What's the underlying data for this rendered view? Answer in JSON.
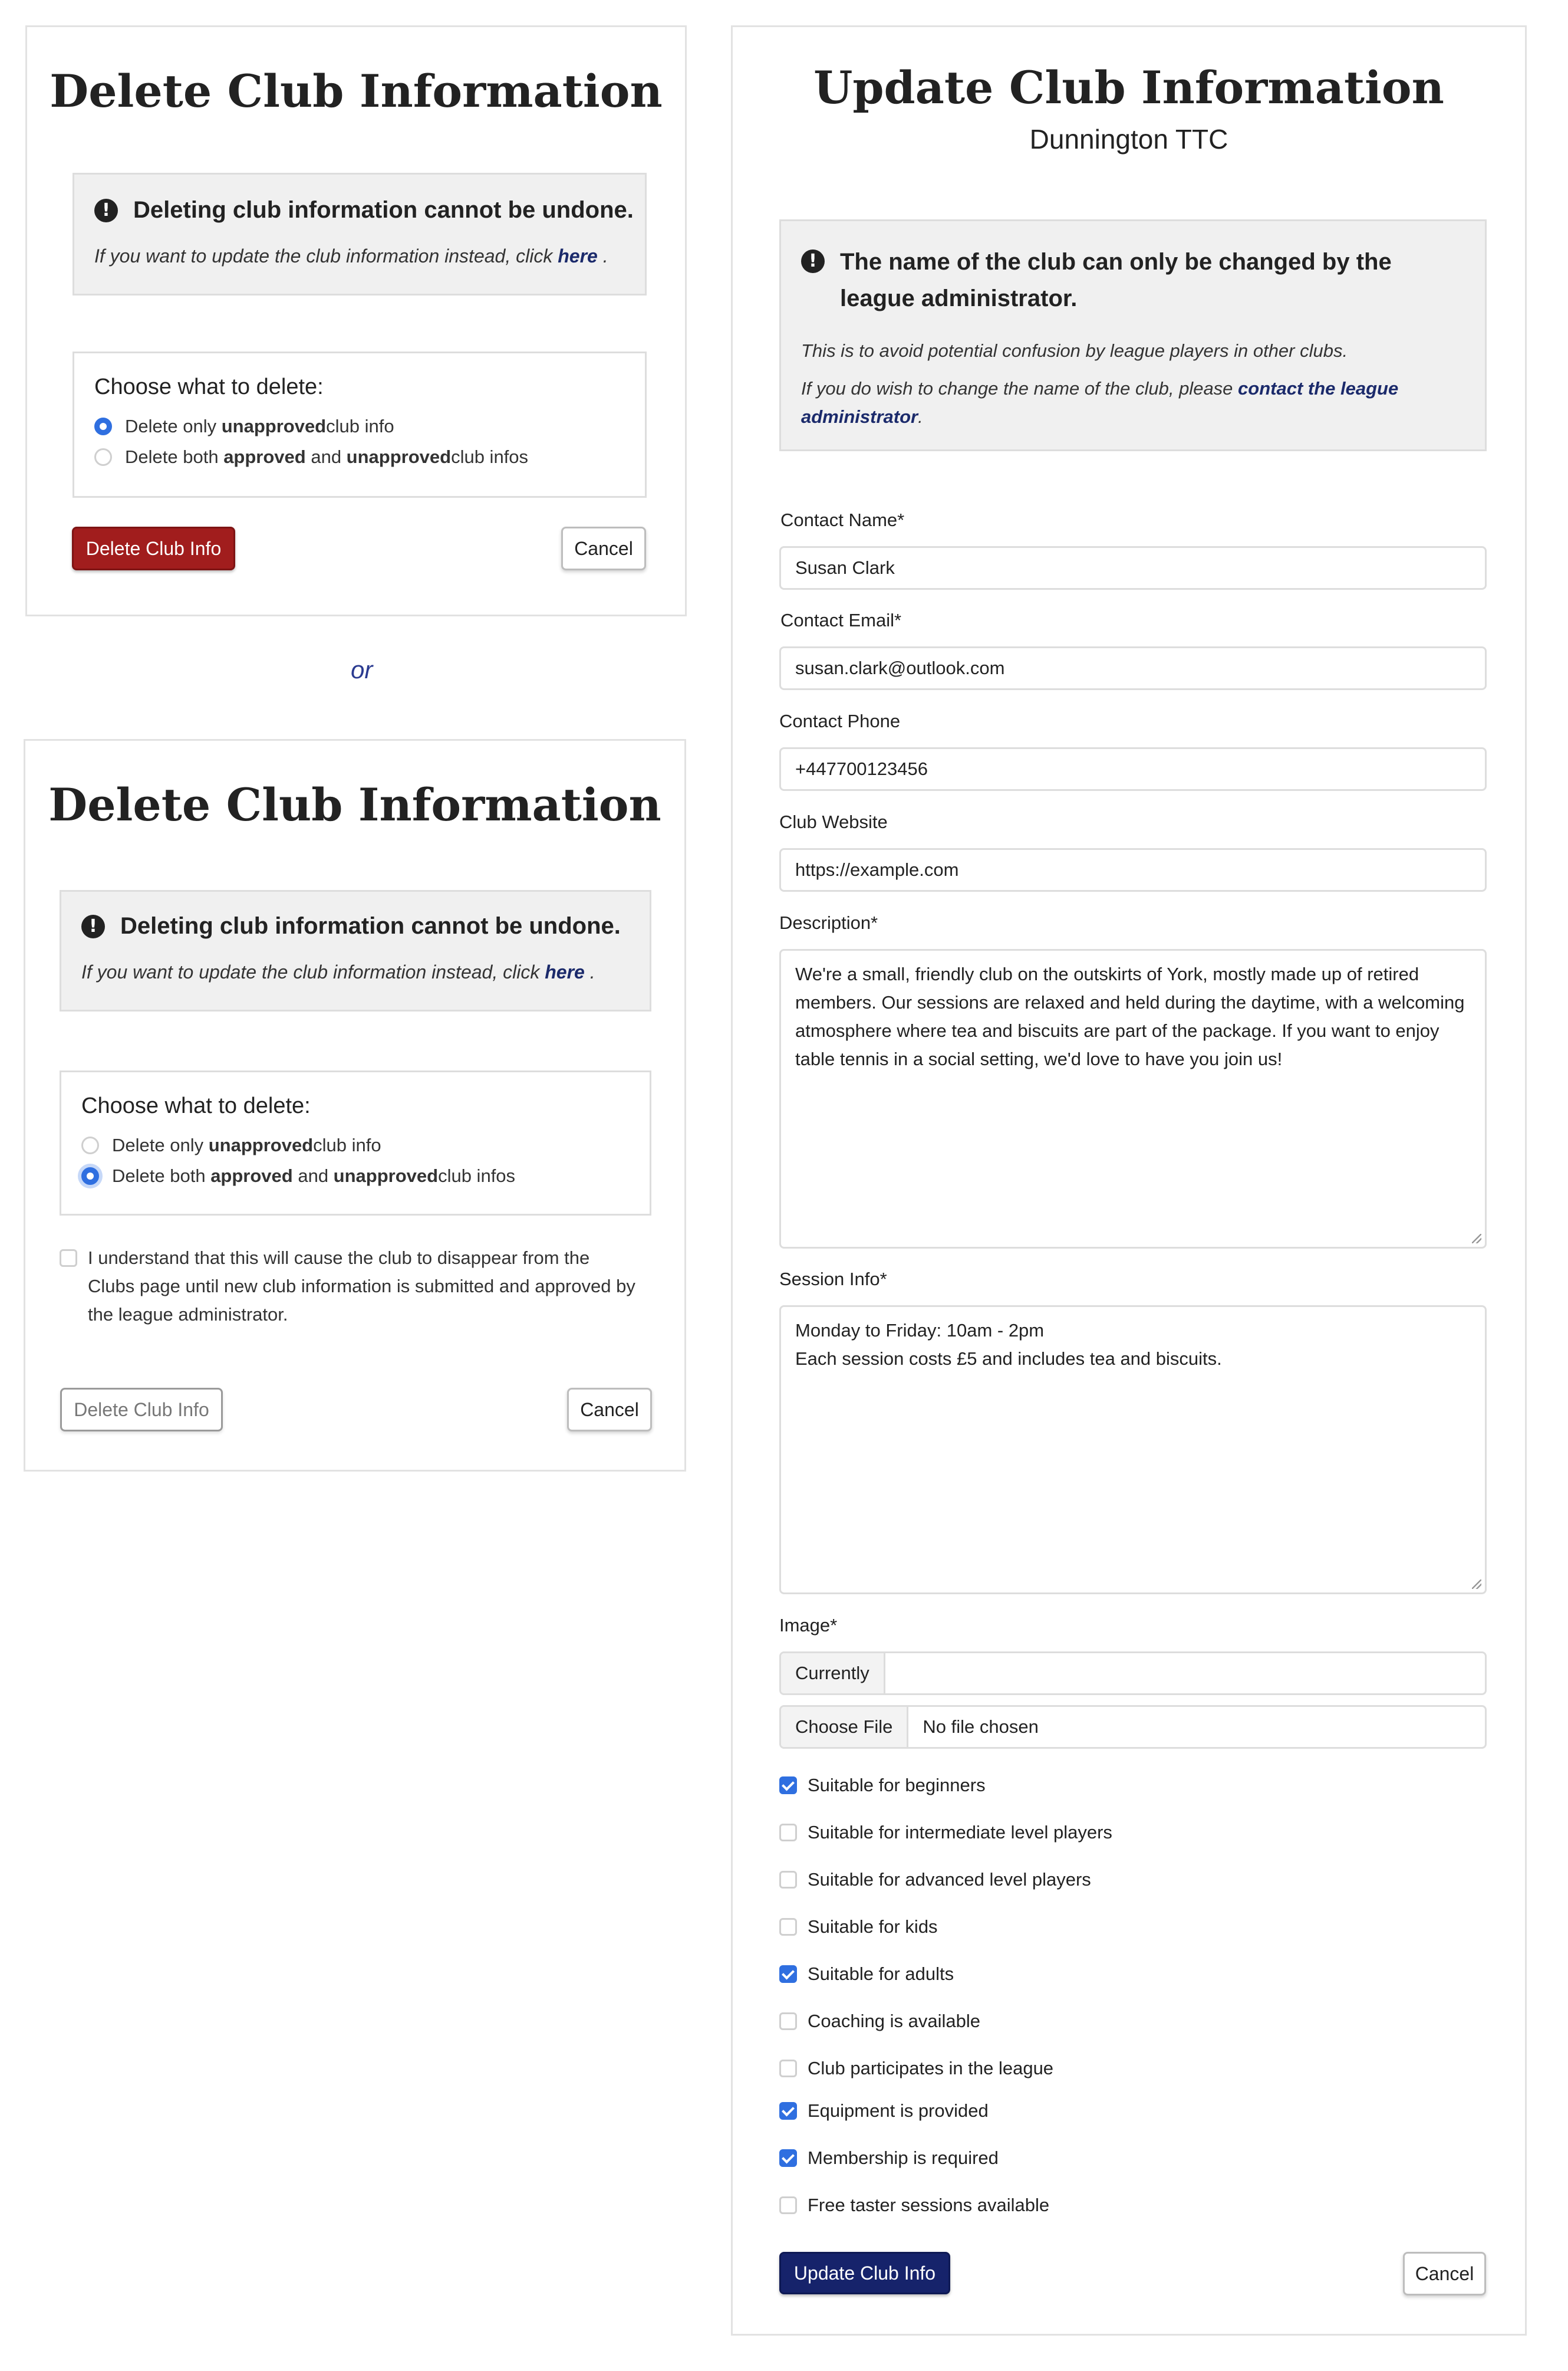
{
  "delete_panel_1": {
    "title": "Delete Club Information",
    "warning": {
      "heading": "Deleting club information cannot be undone.",
      "text_before": "If you want to update the club information instead, click ",
      "link": "here",
      "text_after": " ."
    },
    "choose_title": "Choose what to delete:",
    "options": [
      {
        "pre": "Delete only ",
        "bold1": "unapproved",
        "mid": "",
        "bold2": "",
        "post": " club info",
        "selected": true
      },
      {
        "pre": "Delete both ",
        "bold1": "approved",
        "mid": " and ",
        "bold2": "unapproved",
        "post": " club infos",
        "selected": false
      }
    ],
    "delete_label": "Delete Club Info",
    "cancel_label": "Cancel"
  },
  "separator": "or",
  "delete_panel_2": {
    "title": "Delete Club Information",
    "warning": {
      "heading": "Deleting club information cannot be undone.",
      "text_before": "If you want to update the club information instead, click ",
      "link": "here",
      "text_after": " ."
    },
    "choose_title": "Choose what to delete:",
    "options": [
      {
        "pre": "Delete only ",
        "bold1": "unapproved",
        "mid": "",
        "bold2": "",
        "post": " club info",
        "selected": false
      },
      {
        "pre": "Delete both ",
        "bold1": "approved",
        "mid": " and ",
        "bold2": "unapproved",
        "post": " club infos",
        "selected": true
      }
    ],
    "acknowledge": "I understand that this will cause the club to disappear from the Clubs page until new club information is submitted and approved by the league administrator.",
    "acknowledge_checked": false,
    "delete_label": "Delete Club Info",
    "cancel_label": "Cancel"
  },
  "update_panel": {
    "title": "Update Club Information",
    "club_name": "Dunnington TTC",
    "notice": {
      "heading": "The name of the club can only be changed by the league administrator.",
      "line1": "This is to avoid potential confusion by league players in other clubs.",
      "line2_before": "If you do wish to change the name of the club, please ",
      "line2_link": "contact the league administrator",
      "line2_after": "."
    },
    "fields": {
      "contact_name": {
        "label": "Contact Name*",
        "value": "Susan Clark"
      },
      "contact_email": {
        "label": "Contact Email*",
        "value": "susan.clark@outlook.com"
      },
      "contact_phone": {
        "label": "Contact Phone",
        "value": "+447700123456"
      },
      "club_website": {
        "label": "Club Website",
        "value": "https://example.com"
      },
      "description": {
        "label": "Description*",
        "value": "We're a small, friendly club on the outskirts of York, mostly made up of retired members. Our sessions are relaxed and held during the daytime, with a welcoming atmosphere where tea and biscuits are part of the package. If you want to enjoy table tennis in a social setting, we'd love to have you join us!"
      },
      "session_info": {
        "label": "Session Info*",
        "line1": "Monday to Friday: 10am - 2pm",
        "line2": "Each session costs £5 and includes tea and biscuits."
      },
      "image": {
        "label": "Image*",
        "currently_label": "Currently",
        "currently_value": "",
        "choose_label": "Choose File",
        "file_status": "No file chosen"
      }
    },
    "checkboxes": [
      {
        "label": "Suitable for beginners",
        "checked": true
      },
      {
        "label": "Suitable for intermediate level players",
        "checked": false
      },
      {
        "label": "Suitable for advanced level players",
        "checked": false
      },
      {
        "label": "Suitable for kids",
        "checked": false
      },
      {
        "label": "Suitable for adults",
        "checked": true
      },
      {
        "label": "Coaching is available",
        "checked": false
      },
      {
        "label": "Club participates in the league",
        "checked": false
      },
      {
        "label": "Equipment is provided",
        "checked": true
      },
      {
        "label": "Membership is required",
        "checked": true
      },
      {
        "label": "Free taster sessions available",
        "checked": false
      }
    ],
    "submit_label": "Update Club Info",
    "cancel_label": "Cancel"
  }
}
